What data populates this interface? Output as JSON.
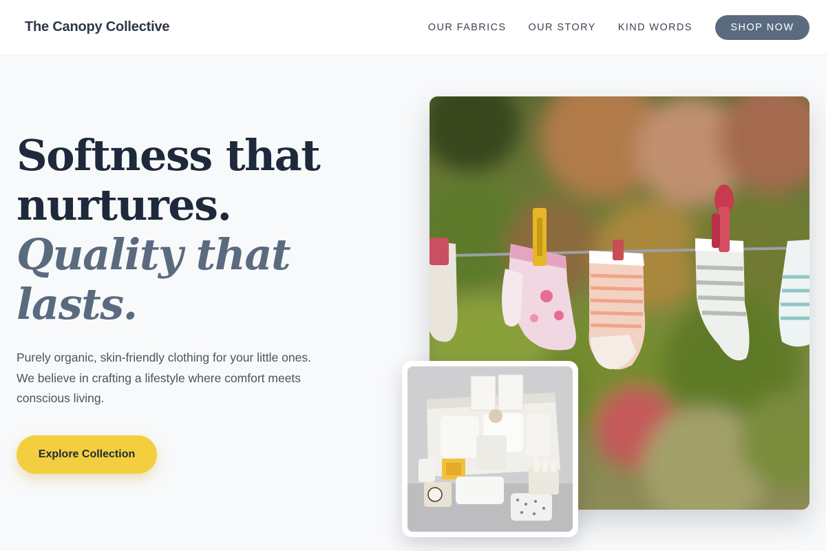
{
  "header": {
    "brand": "The Canopy Collective",
    "nav": [
      {
        "label": "OUR FABRICS"
      },
      {
        "label": "OUR STORY"
      },
      {
        "label": "KIND WORDS"
      }
    ],
    "cta_label": "SHOP NOW"
  },
  "hero": {
    "heading_line1": "Softness that",
    "heading_line2": "nurtures.",
    "heading_accent_line1": "Quality that",
    "heading_accent_line2": "lasts.",
    "description": "Purely organic, skin-friendly clothing for your little ones. We believe in crafting a lifestyle where comfort meets conscious living.",
    "cta_label": "Explore Collection"
  },
  "colors": {
    "accent_yellow": "#f3cf3f",
    "slate": "#5a6b7f",
    "navy": "#1e293b",
    "background": "#f8f9fa"
  }
}
